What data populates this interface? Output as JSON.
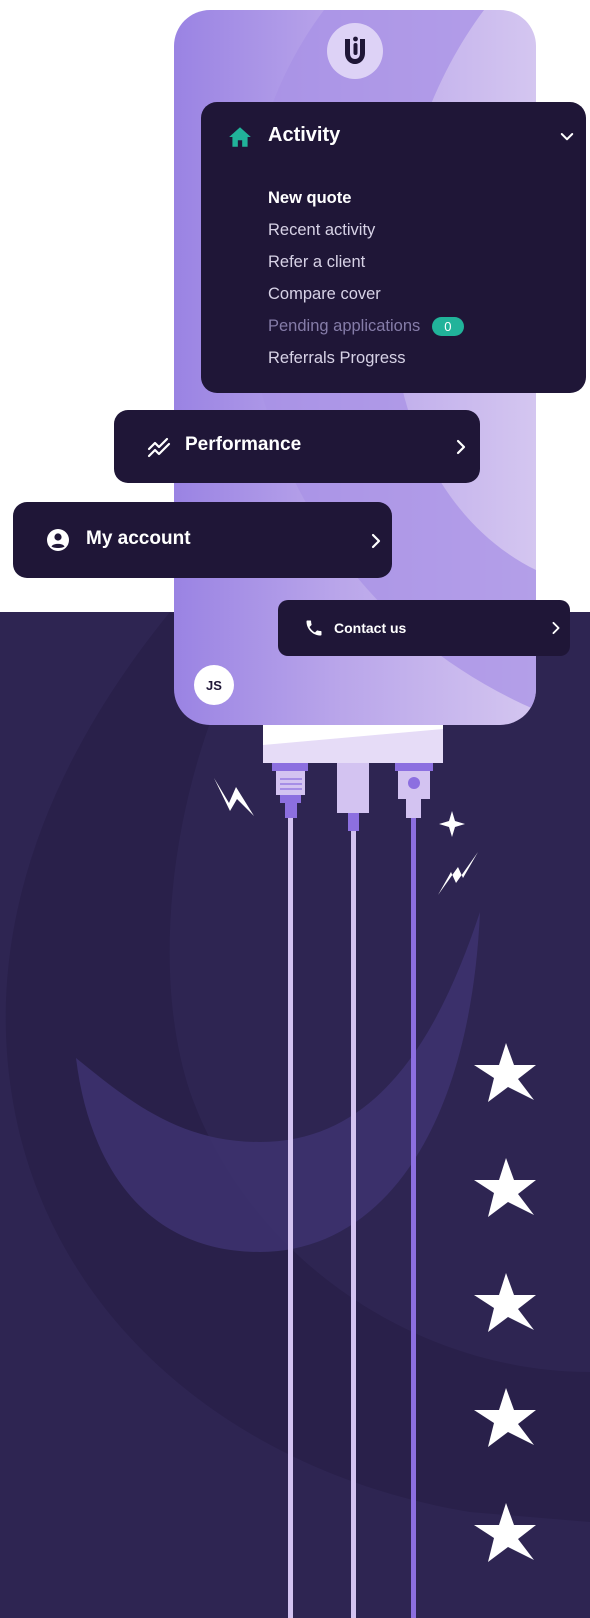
{
  "app": {
    "logo_name": "u-logo-icon",
    "avatar_initials": "JS"
  },
  "activity": {
    "label": "Activity",
    "icon": "home-icon",
    "expanded": true,
    "items": [
      {
        "label": "New quote",
        "state": "active"
      },
      {
        "label": "Recent activity",
        "state": "normal"
      },
      {
        "label": "Refer a client",
        "state": "normal"
      },
      {
        "label": "Compare cover",
        "state": "normal"
      },
      {
        "label": "Pending applications",
        "state": "muted",
        "badge": "0"
      },
      {
        "label": "Referrals Progress",
        "state": "normal"
      }
    ]
  },
  "performance": {
    "label": "Performance",
    "icon": "trend-chart-icon"
  },
  "my_account": {
    "label": "My account",
    "icon": "user-circle-icon"
  },
  "contact": {
    "label": "Contact us",
    "icon": "phone-icon"
  },
  "rating": {
    "stars": 5
  },
  "colors": {
    "card_bg": "#1f1637",
    "accent_green": "#21b39a",
    "phone_gradient_start": "#9a83e3",
    "phone_gradient_end": "#d4c6f0",
    "background_dark": "#2e2552"
  }
}
